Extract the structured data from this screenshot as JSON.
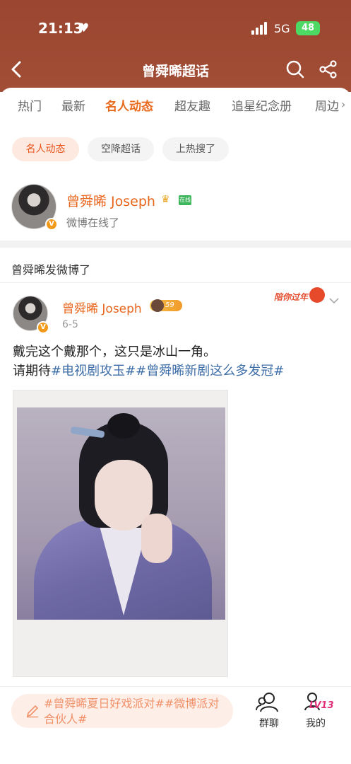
{
  "status_bar": {
    "time": "21:13",
    "network": "5G",
    "battery": "48"
  },
  "nav": {
    "title": "曾舜晞超话"
  },
  "tabs": [
    {
      "label": "热门",
      "active": false
    },
    {
      "label": "最新",
      "active": false
    },
    {
      "label": "名人动态",
      "active": true
    },
    {
      "label": "超友趣",
      "active": false
    },
    {
      "label": "追星纪念册",
      "active": false
    },
    {
      "label": "周边",
      "active": false
    }
  ],
  "chips": [
    {
      "label": "名人动态",
      "active": true
    },
    {
      "label": "空降超话",
      "active": false
    },
    {
      "label": "上热搜了",
      "active": false
    }
  ],
  "profile": {
    "name": "曾舜晞 Joseph",
    "online_badge": "在线",
    "subtitle": "微博在线了",
    "verified": "V"
  },
  "section_title": "曾舜晞发微博了",
  "post": {
    "author": "曾舜晞 Joseph",
    "level": "59",
    "date": "6-5",
    "festive_text": "陪你过年",
    "text_line1": "戴完这个戴那个，这只是冰山一角。",
    "text_prefix": "请期待",
    "tag1": "#电视剧攻玉#",
    "tag2": "#曾舜晞新剧这么多发冠#"
  },
  "bottom_bar": {
    "compose_text": "#曾舜晞夏日好戏派对##微博派对合伙人#",
    "group_chat_label": "群聊",
    "me_label": "我的",
    "me_level": "LV13"
  },
  "colors": {
    "header_bg": "#a24e36",
    "accent": "#e86a1c",
    "tag_link": "#3e6ea8"
  }
}
